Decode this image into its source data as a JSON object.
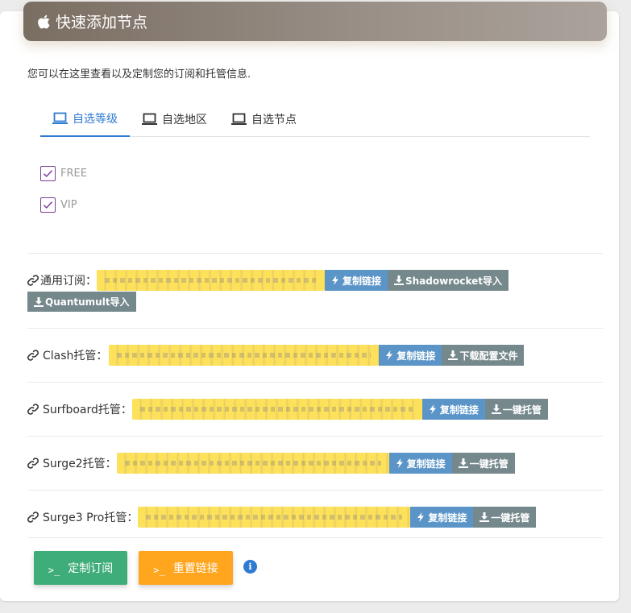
{
  "header": {
    "title": "快速添加节点"
  },
  "subtitle": "您可以在这里查看以及定制您的订阅和托管信息.",
  "tabs": [
    {
      "label": "自选等级"
    },
    {
      "label": "自选地区"
    },
    {
      "label": "自选节点"
    }
  ],
  "levels": [
    {
      "label": "FREE",
      "checked": true
    },
    {
      "label": "VIP",
      "checked": true
    }
  ],
  "rows": [
    {
      "label": "通用订阅：",
      "copy": "复制链接",
      "actions": [
        "Shadowrocket导入",
        "Quantumult导入"
      ]
    },
    {
      "label": "Clash托管：",
      "copy": "复制链接",
      "actions": [
        "下载配置文件"
      ]
    },
    {
      "label": "Surfboard托管：",
      "copy": "复制链接",
      "actions": [
        "一键托管"
      ]
    },
    {
      "label": "Surge2托管：",
      "copy": "复制链接",
      "actions": [
        "一键托管"
      ]
    },
    {
      "label": "Surge3 Pro托管：",
      "copy": "复制链接",
      "actions": [
        "一键托管"
      ]
    }
  ],
  "footer": {
    "customize": {
      "label": "定制订阅",
      "prompt": ">_",
      "color": "#3fad7a"
    },
    "reset": {
      "label": "重置链接",
      "prompt": ">_",
      "color": "#ffa51e"
    },
    "info_glyph": "i"
  },
  "colors": {
    "accent": "#2f7bd1",
    "copy_button": "#5b95c8",
    "action_button": "#75888c",
    "masked_link": "#fde15a",
    "checkbox": "#7d3c98"
  }
}
